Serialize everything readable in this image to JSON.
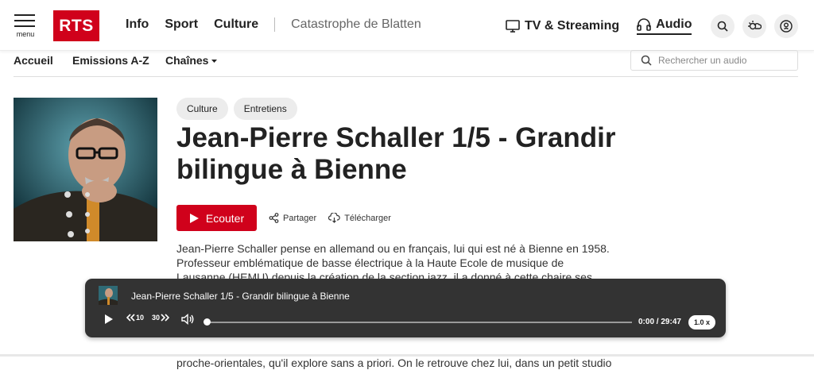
{
  "header": {
    "menu_label": "menu",
    "logo": "RTS",
    "nav": [
      "Info",
      "Sport",
      "Culture"
    ],
    "topic": "Catastrophe de Blatten",
    "tv_label": "TV & Streaming",
    "audio_label": "Audio"
  },
  "subnav": {
    "items": [
      "Accueil",
      "Emissions A-Z",
      "Chaînes"
    ],
    "search_placeholder": "Rechercher un audio"
  },
  "episode": {
    "tags": [
      "Culture",
      "Entretiens"
    ],
    "title": "Jean-Pierre Schaller 1/5 - Grandir bilingue à Bienne",
    "listen_label": "Ecouter",
    "share_label": "Partager",
    "download_label": "Télécharger",
    "description_1": "Jean-Pierre Schaller pense en allemand ou en français, lui qui est né à Bienne en 1958.",
    "description_2": "Professeur emblématique de basse électrique à la Haute Ecole de musique de",
    "description_3": "Lausanne (HEMU) depuis la création de la section jazz, il a donné à cette chaire ses",
    "description_4": "proche-orientales, qu'il explore sans a priori. On le retrouve chez lui, dans un petit studio"
  },
  "player": {
    "title": "Jean-Pierre Schaller 1/5 - Grandir bilingue à Bienne",
    "back_label": "10",
    "forward_label": "30",
    "current_time": "0:00",
    "separator": "/",
    "duration": "29:47",
    "speed": "1.0 x",
    "progress": 0
  },
  "colors": {
    "brand_red": "#d0011b",
    "player_bg": "#333333"
  }
}
